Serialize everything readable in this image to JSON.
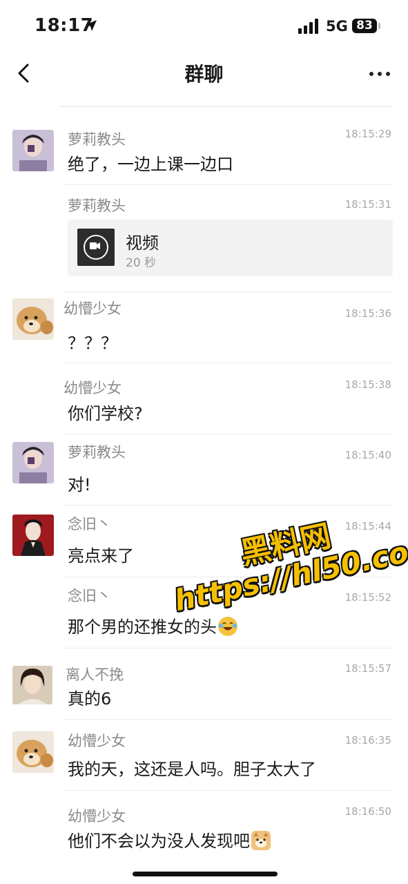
{
  "status_bar": {
    "time": "18:17",
    "network": "5G",
    "battery": "83"
  },
  "nav": {
    "title": "群聊"
  },
  "messages": [
    {
      "sender": "萝莉教头",
      "time": "18:15:29",
      "text": "绝了，一边上课一边口"
    },
    {
      "sender": "萝莉教头",
      "time": "18:15:31",
      "video": {
        "title": "视频",
        "duration": "20 秒"
      }
    },
    {
      "sender": "幼懵少女",
      "time": "18:15:36",
      "text": "？？？"
    },
    {
      "sender": "幼懵少女",
      "time": "18:15:38",
      "text": "你们学校?"
    },
    {
      "sender": "萝莉教头",
      "time": "18:15:40",
      "text": "对!"
    },
    {
      "sender": "念旧丶",
      "time": "18:15:44",
      "text": "亮点来了"
    },
    {
      "sender": "念旧丶",
      "time": "18:15:52",
      "text": "那个男的还推女的头"
    },
    {
      "sender": "离人不挽",
      "time": "18:15:57",
      "text": "真的6"
    },
    {
      "sender": "幼懵少女",
      "time": "18:16:35",
      "text": "我的天，这还是人吗。胆子太大了"
    },
    {
      "sender": "幼懵少女",
      "time": "18:16:50",
      "text": "他们不会以为没人发现吧"
    }
  ],
  "watermark": {
    "line1": "黑料网",
    "line2": "https://hl50.co"
  }
}
